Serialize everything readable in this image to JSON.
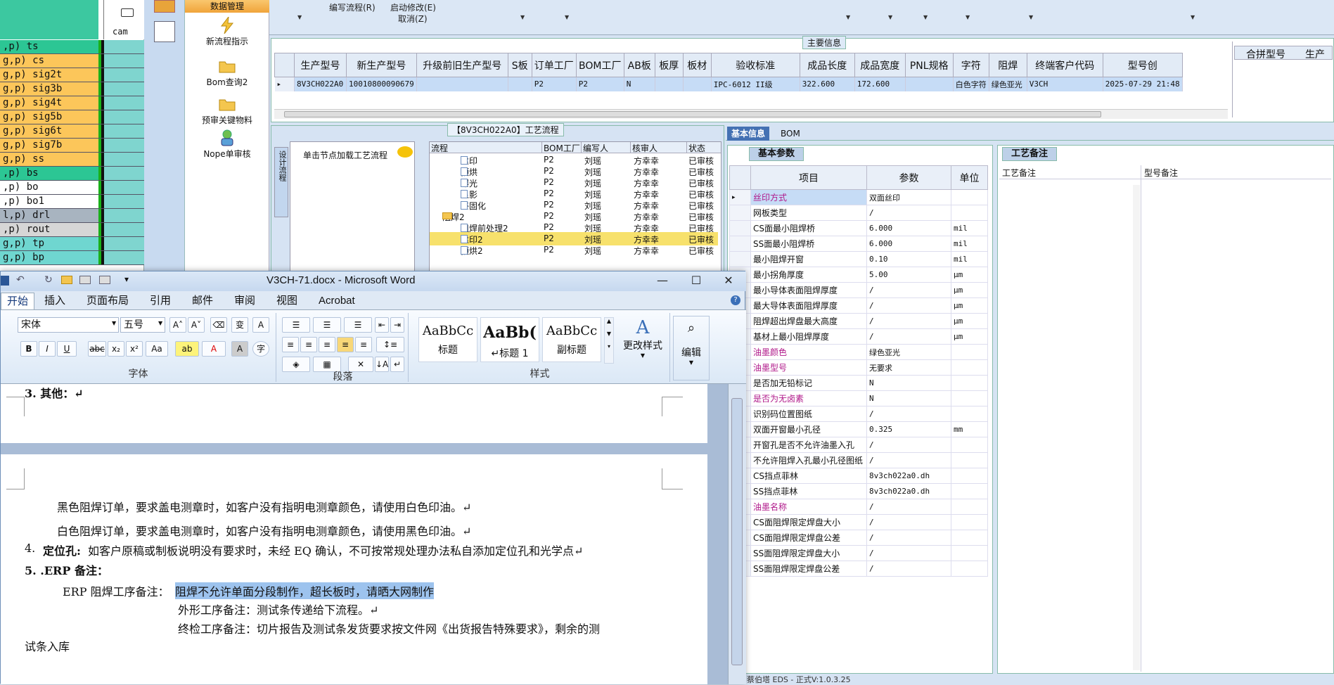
{
  "layers": {
    "cam_header": "cam",
    "rows": [
      {
        "name": ",p) ts",
        "color": "#2cc694"
      },
      {
        "name": "g,p) cs",
        "color": "#fcc65a"
      },
      {
        "name": "g,p) sig2t",
        "color": "#fcc65a"
      },
      {
        "name": "g,p) sig3b",
        "color": "#fcc65a"
      },
      {
        "name": "g,p) sig4t",
        "color": "#fcc65a"
      },
      {
        "name": "g,p) sig5b",
        "color": "#fcc65a"
      },
      {
        "name": "g,p) sig6t",
        "color": "#fcc65a"
      },
      {
        "name": "g,p) sig7b",
        "color": "#fcc65a"
      },
      {
        "name": "g,p) ss",
        "color": "#fcc65a"
      },
      {
        "name": ",p) bs",
        "color": "#2cc694"
      },
      {
        "name": ",p) bo",
        "color": "#ffffff"
      },
      {
        "name": ",p) bo1",
        "color": "#ffffff"
      },
      {
        "name": "l,p) drl",
        "color": "#a8b4c0"
      },
      {
        "name": ",p) rout",
        "color": "#d6d6d6"
      },
      {
        "name": "g,p) tp",
        "color": "#6fd6d0"
      },
      {
        "name": "g,p) bp",
        "color": "#6fd6d0"
      }
    ]
  },
  "nav": {
    "title": "数据管理",
    "items": [
      "新流程指示",
      "Bom查询2",
      "预审关键物料",
      "Nope单审核"
    ]
  },
  "topmenu": {
    "write_flow": "编写流程(R)",
    "start_modify": "启动修改(E)",
    "cancel": "取消(Z)"
  },
  "main_info": {
    "legend": "主要信息",
    "columns": [
      "生产型号",
      "新生产型号",
      "升级前旧生产型号",
      "S板",
      "订单工厂",
      "BOM工厂",
      "AB板",
      "板厚",
      "板材",
      "验收标准",
      "成品长度",
      "成品宽度",
      "PNL规格",
      "字符",
      "阻焊",
      "终端客户代码",
      "型号创"
    ],
    "row": [
      "8V3CH022A0",
      "10010800090679",
      "",
      "",
      "P2",
      "P2",
      "N",
      "",
      "",
      "IPC-6012 II级",
      "322.600",
      "172.600",
      "",
      "白色字符",
      "绿色亚光",
      "V3CH",
      "2025-07-29 21:48"
    ],
    "extra_columns": [
      "合拼型号",
      "生产"
    ]
  },
  "process": {
    "legend": "【8V3CH022A0】工艺流程",
    "side_tab": "设计流程",
    "hint": "单击节点加载工艺流程",
    "columns": [
      "流程",
      "BOM工厂",
      "编写人",
      "核审人",
      "状态"
    ],
    "rows": [
      {
        "name": "丝印",
        "factory": "P2",
        "writer": "刘瑶",
        "reviewer": "方幸幸",
        "status": "已审核",
        "type": "leaf",
        "indent": 1
      },
      {
        "name": "预烘",
        "factory": "P2",
        "writer": "刘瑶",
        "reviewer": "方幸幸",
        "status": "已审核",
        "type": "leaf",
        "indent": 1
      },
      {
        "name": "曝光",
        "factory": "P2",
        "writer": "刘瑶",
        "reviewer": "方幸幸",
        "status": "已审核",
        "type": "leaf",
        "indent": 1
      },
      {
        "name": "显影",
        "factory": "P2",
        "writer": "刘瑶",
        "reviewer": "方幸幸",
        "status": "已审核",
        "type": "leaf",
        "indent": 1
      },
      {
        "name": "终固化",
        "factory": "P2",
        "writer": "刘瑶",
        "reviewer": "方幸幸",
        "status": "已审核",
        "type": "leaf",
        "indent": 1
      },
      {
        "name": "阻焊2",
        "factory": "P2",
        "writer": "刘瑶",
        "reviewer": "方幸幸",
        "status": "已审核",
        "type": "folder",
        "indent": 0
      },
      {
        "name": "阻焊前处理2",
        "factory": "P2",
        "writer": "刘瑶",
        "reviewer": "方幸幸",
        "status": "已审核",
        "type": "leaf",
        "indent": 1
      },
      {
        "name": "丝印2",
        "factory": "P2",
        "writer": "刘瑶",
        "reviewer": "方幸幸",
        "status": "已审核",
        "type": "leaf",
        "indent": 1
      },
      {
        "name": "预烘2",
        "factory": "P2",
        "writer": "刘瑶",
        "reviewer": "方幸幸",
        "status": "已审核",
        "type": "leaf",
        "indent": 1
      }
    ]
  },
  "info": {
    "tabs": [
      "基本信息",
      "BOM"
    ],
    "section_title": "基本参数",
    "notes_title": "工艺备注",
    "columns": [
      "项目",
      "参数",
      "单位"
    ],
    "notes_columns": [
      "工艺备注",
      "型号备注"
    ],
    "params": [
      {
        "key": "丝印方式",
        "val": "双面丝印",
        "unit": "",
        "mag": true
      },
      {
        "key": "网板类型",
        "val": "/",
        "unit": "",
        "mag": false
      },
      {
        "key": "CS面最小阻焊桥",
        "val": "6.000",
        "unit": "mil",
        "mag": false
      },
      {
        "key": "SS面最小阻焊桥",
        "val": "6.000",
        "unit": "mil",
        "mag": false
      },
      {
        "key": "最小阻焊开窗",
        "val": "0.10",
        "unit": "mil",
        "mag": false
      },
      {
        "key": "最小拐角厚度",
        "val": "5.00",
        "unit": "μm",
        "mag": false
      },
      {
        "key": "最小导体表面阻焊厚度",
        "val": "/",
        "unit": "μm",
        "mag": false
      },
      {
        "key": "最大导体表面阻焊厚度",
        "val": "/",
        "unit": "μm",
        "mag": false
      },
      {
        "key": "阻焊超出焊盘最大高度",
        "val": "/",
        "unit": "μm",
        "mag": false
      },
      {
        "key": "基材上最小阻焊厚度",
        "val": "/",
        "unit": "μm",
        "mag": false
      },
      {
        "key": "油墨颜色",
        "val": "绿色亚光",
        "unit": "",
        "mag": true
      },
      {
        "key": "油墨型号",
        "val": "无要求",
        "unit": "",
        "mag": true
      },
      {
        "key": "是否加无铅标记",
        "val": "N",
        "unit": "",
        "mag": false
      },
      {
        "key": "是否为无卤素",
        "val": "N",
        "unit": "",
        "mag": true
      },
      {
        "key": "识别码位置图纸",
        "val": "/",
        "unit": "",
        "mag": false
      },
      {
        "key": "双面开窗最小孔径",
        "val": "0.325",
        "unit": "mm",
        "mag": false
      },
      {
        "key": "开窗孔是否不允许油墨入孔",
        "val": "/",
        "unit": "",
        "mag": false
      },
      {
        "key": "不允许阻焊入孔最小孔径图纸",
        "val": "/",
        "unit": "",
        "mag": false
      },
      {
        "key": "CS挡点菲林",
        "val": "8v3ch022a0.dh",
        "unit": "",
        "mag": false
      },
      {
        "key": "SS挡点菲林",
        "val": "8v3ch022a0.dh",
        "unit": "",
        "mag": false
      },
      {
        "key": "油墨名称",
        "val": "/",
        "unit": "",
        "mag": true
      },
      {
        "key": "CS面阻焊限定焊盘大小",
        "val": "/",
        "unit": "",
        "mag": false
      },
      {
        "key": "CS面阻焊限定焊盘公差",
        "val": "/",
        "unit": "",
        "mag": false
      },
      {
        "key": "SS面阻焊限定焊盘大小",
        "val": "/",
        "unit": "",
        "mag": false
      },
      {
        "key": "SS面阻焊限定焊盘公差",
        "val": "/",
        "unit": "",
        "mag": false
      }
    ]
  },
  "word": {
    "title": "V3CH-71.docx - Microsoft Word",
    "tabs": [
      "开始",
      "插入",
      "页面布局",
      "引用",
      "邮件",
      "审阅",
      "视图",
      "Acrobat"
    ],
    "font_name": "宋体",
    "font_size": "五号",
    "group_font": "字体",
    "group_para": "段落",
    "group_style": "样式",
    "styles": [
      {
        "sample": "AaBbCc",
        "name": "标题"
      },
      {
        "sample": "AaBb(",
        "name": "↵标题 1"
      },
      {
        "sample": "AaBbCc",
        "name": "副标题"
      }
    ],
    "change_style": "更改样式",
    "edit": "编辑",
    "doc": {
      "top_cut": "3.  其他：↵",
      "line1": "黑色阻焊订单，要求盖电测章时，如客户没有指明电测章颜色，请使用白色印油。↵",
      "line2": "白色阻焊订单，要求盖电测章时，如客户没有指明电测章颜色，请使用黑色印油。↵",
      "item4_num": "4.",
      "item4_bold": "定位孔:",
      "item4_text": "如客户原稿或制板说明没有要求时，未经 EQ 确认，不可按常规处理办法私自添加定位孔和光学点↵",
      "item5": "5. .ERP 备注：",
      "erp_label": "ERP 阻焊工序备注：",
      "erp_selected": "阻焊不允许单面分段制作，超长板时，请晒大网制作",
      "shape_note": "外形工序备注：测试条传递给下流程。↵",
      "final_note": "终检工序备注：切片报告及测试条发货要求按文件网《出货报告特殊要求》，剩余的测",
      "final_tail": "试条入库"
    }
  },
  "status": "蔡伯塔 EDS - 正式V:1.0.3.25"
}
